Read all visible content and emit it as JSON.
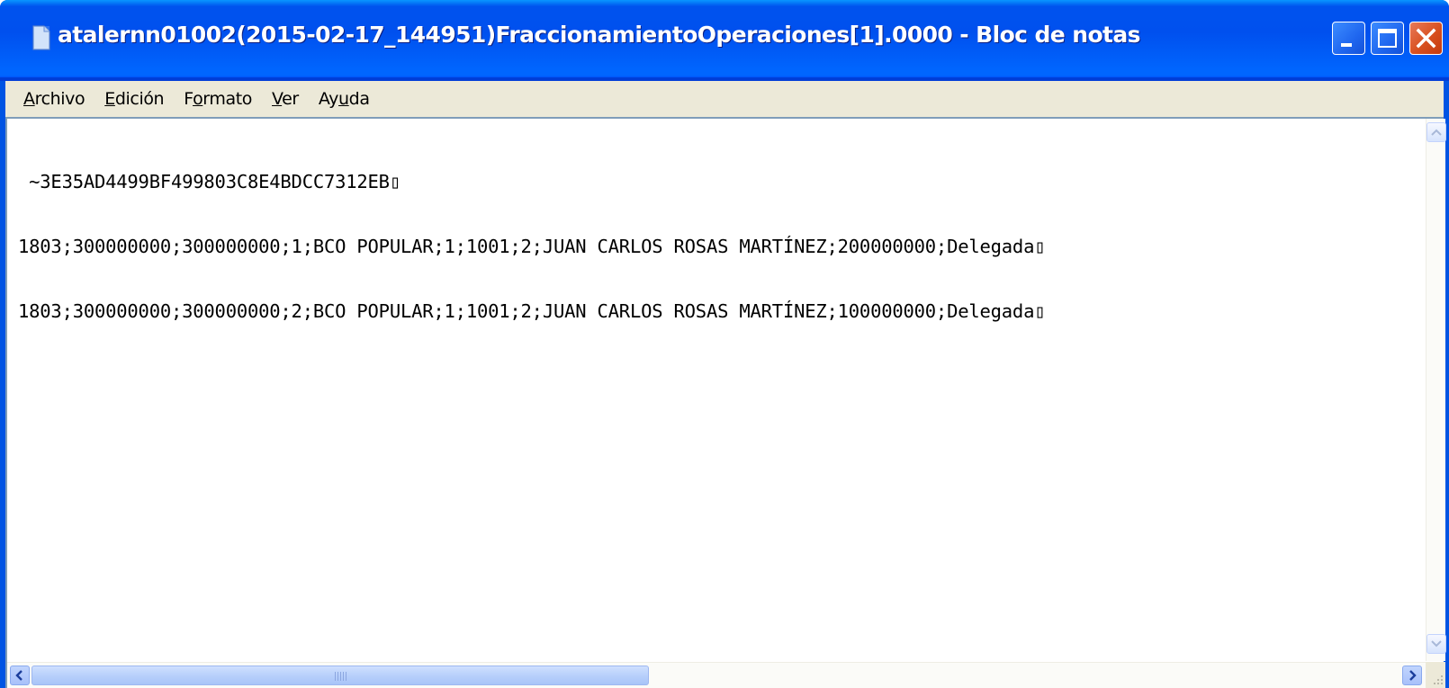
{
  "window": {
    "title": "atalernn01002(2015-02-17_144951)FraccionamientoOperaciones[1].0000 - Bloc de notas",
    "app_icon": "notepad-icon",
    "controls": [
      "minimize-icon",
      "maximize-icon",
      "close-icon"
    ]
  },
  "menu": {
    "items": [
      {
        "prefix": "",
        "accel": "A",
        "suffix": "rchivo"
      },
      {
        "prefix": "",
        "accel": "E",
        "suffix": "dición"
      },
      {
        "prefix": "F",
        "accel": "o",
        "suffix": "rmato"
      },
      {
        "prefix": "",
        "accel": "V",
        "suffix": "er"
      },
      {
        "prefix": "Ay",
        "accel": "u",
        "suffix": "da"
      }
    ]
  },
  "document": {
    "lines": [
      " ~3E35AD4499BF499803C8E4BDCC7312EB▯",
      "1803;300000000;300000000;1;BCO POPULAR;1;1001;2;JUAN CARLOS ROSAS MARTÍNEZ;200000000;Delegada▯",
      "1803;300000000;300000000;2;BCO POPULAR;1;1001;2;JUAN CARLOS ROSAS MARTÍNEZ;100000000;Delegada▯"
    ]
  },
  "colors": {
    "titlebar": "#0054e3",
    "menubar": "#ece9d8",
    "close_button": "#d8501f"
  }
}
